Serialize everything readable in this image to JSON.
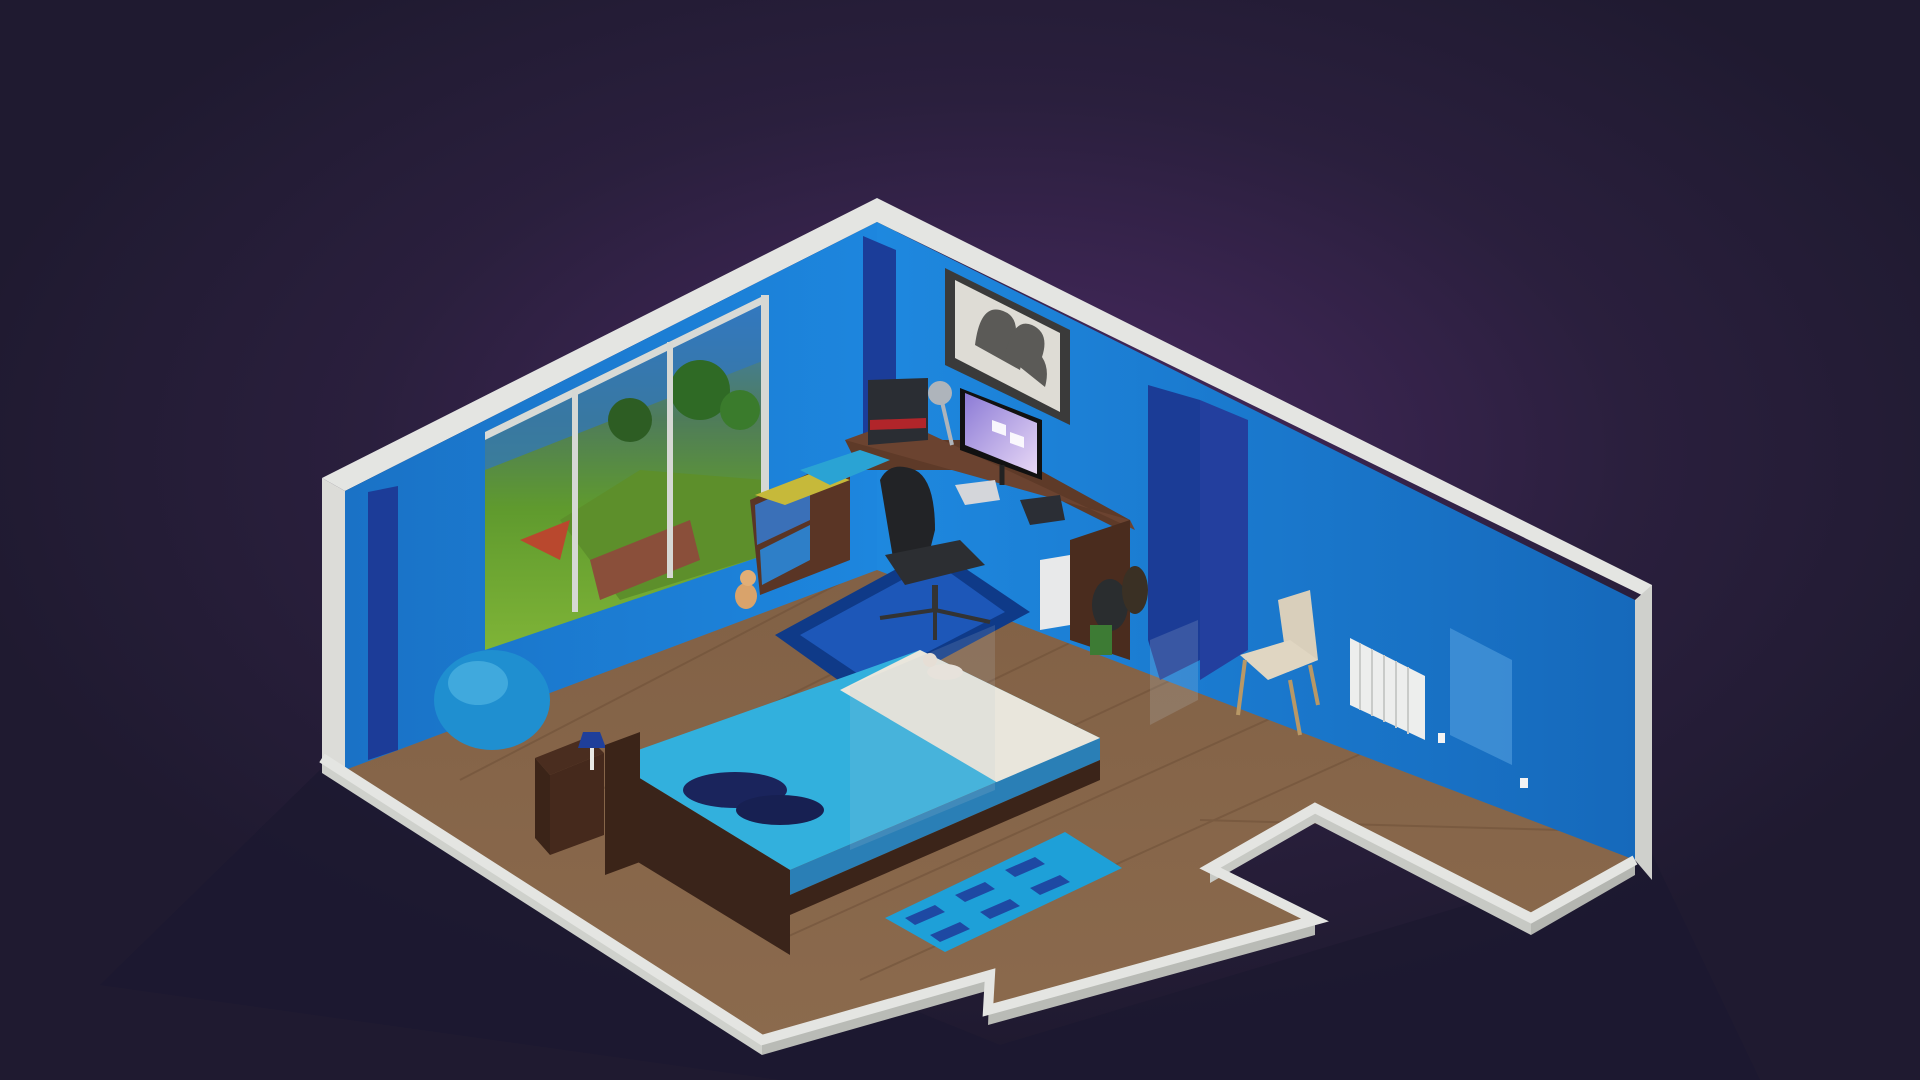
{
  "scene": {
    "type": "isometric-room-builder",
    "background": "#1f1a30",
    "glow": "#3f2456",
    "colors": {
      "wall_blue": "#1d82d9",
      "wall_blue_dark": "#155fb0",
      "wall_rim": "#e3e4e3",
      "floor_wood": "#86644a",
      "floor_wood_dark": "#6f5139",
      "bed_blanket": "#25a7d6",
      "bed_sheet": "#e9e6dc",
      "desk_wood": "#5a3525",
      "rug": "#1d57b8",
      "curtain": "#1b3d99"
    },
    "objects": [
      {
        "name": "window-landscape",
        "kind": "sliding glass door with outdoor view"
      },
      {
        "name": "framed-picture",
        "kind": "silhouette portrait"
      },
      {
        "name": "monitor",
        "kind": "computer monitor"
      },
      {
        "name": "desk",
        "kind": "corner desk"
      },
      {
        "name": "office-chair",
        "kind": "black swivel chair"
      },
      {
        "name": "bed",
        "kind": "double bed"
      },
      {
        "name": "bean-bag",
        "kind": "blue bean bag"
      },
      {
        "name": "nightstand",
        "kind": "nightstand with lamp"
      },
      {
        "name": "dining-chair",
        "kind": "beige chair"
      },
      {
        "name": "radiator",
        "kind": "white radiator"
      },
      {
        "name": "cat-window",
        "kind": "cat figurine"
      },
      {
        "name": "cat-bed",
        "kind": "cat lying on bed"
      },
      {
        "name": "pixel-rug",
        "kind": "blue patterned rug"
      },
      {
        "name": "desk-rug",
        "kind": "blue square rug"
      }
    ]
  }
}
